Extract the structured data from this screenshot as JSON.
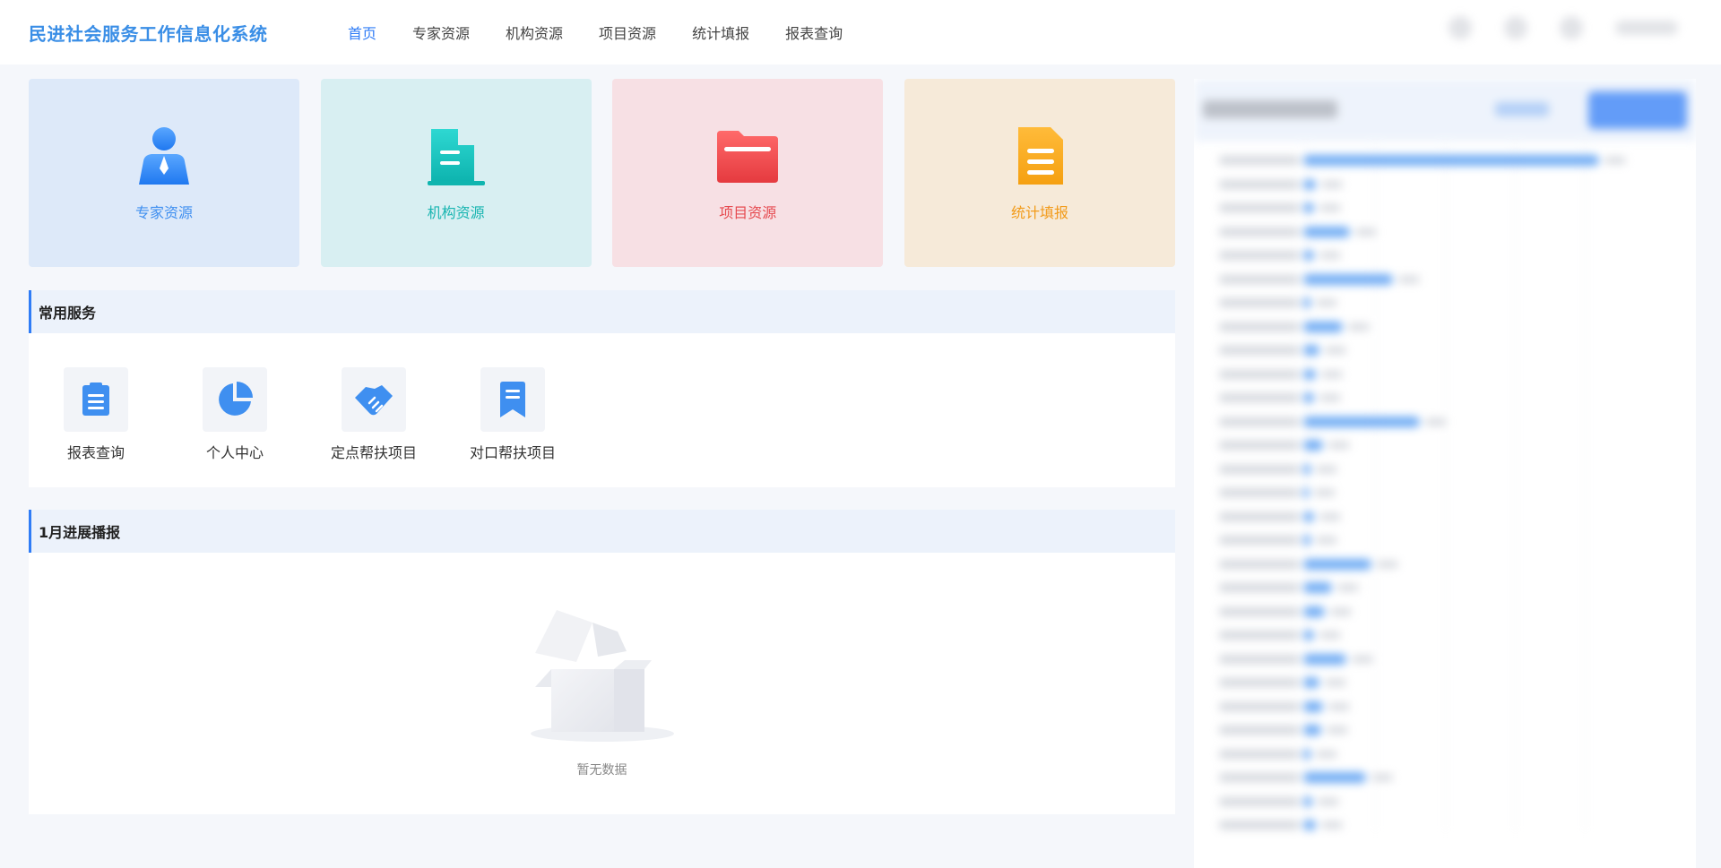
{
  "header": {
    "app_title": "民进社会服务工作信息化系统",
    "nav": [
      {
        "label": "首页",
        "active": true
      },
      {
        "label": "专家资源",
        "active": false
      },
      {
        "label": "机构资源",
        "active": false
      },
      {
        "label": "项目资源",
        "active": false
      },
      {
        "label": "统计填报",
        "active": false
      },
      {
        "label": "报表查询",
        "active": false
      }
    ]
  },
  "cards": [
    {
      "label": "专家资源",
      "icon": "expert-icon",
      "color": "#3f8ff0"
    },
    {
      "label": "机构资源",
      "icon": "building-icon",
      "color": "#19b5b1"
    },
    {
      "label": "项目资源",
      "icon": "folder-icon",
      "color": "#e64a4f"
    },
    {
      "label": "统计填报",
      "icon": "document-icon",
      "color": "#f29b1a"
    }
  ],
  "services": {
    "title": "常用服务",
    "items": [
      {
        "label": "报表查询",
        "icon": "clipboard-icon"
      },
      {
        "label": "个人中心",
        "icon": "pie-chart-icon"
      },
      {
        "label": "定点帮扶项目",
        "icon": "handshake-icon"
      },
      {
        "label": "对口帮扶项目",
        "icon": "bookmark-icon"
      }
    ]
  },
  "progress": {
    "title": "1月进展播报",
    "empty_text": "暂无数据"
  },
  "colors": {
    "primary": "#2f7cf6",
    "title": "#3a8ee6"
  }
}
